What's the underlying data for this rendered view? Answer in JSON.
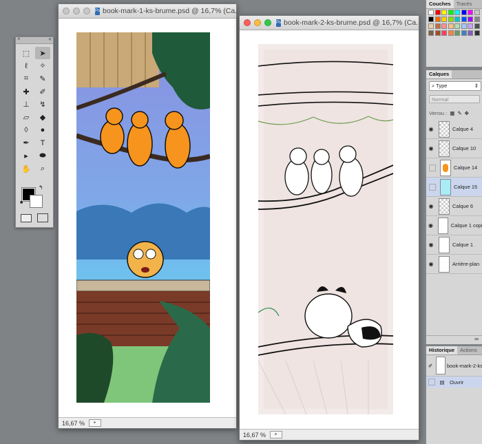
{
  "windows": [
    {
      "title": "book-mark-1-ks-brume.psd @ 16,7% (Ca...",
      "zoom": "16,67 %"
    },
    {
      "title": "book-mark-2-ks-brume.psd @ 16,7% (Ca...",
      "zoom": "16,67 %"
    }
  ],
  "tools": [
    {
      "icon": "marquee-icon",
      "glyph": "⬚"
    },
    {
      "icon": "move-icon",
      "glyph": "➤"
    },
    {
      "icon": "lasso-icon",
      "glyph": "ℓ"
    },
    {
      "icon": "magic-wand-icon",
      "glyph": "✧"
    },
    {
      "icon": "crop-icon",
      "glyph": "⌗"
    },
    {
      "icon": "eyedropper-icon",
      "glyph": "✎"
    },
    {
      "icon": "healing-brush-icon",
      "glyph": "✚"
    },
    {
      "icon": "brush-icon",
      "glyph": "✐"
    },
    {
      "icon": "stamp-icon",
      "glyph": "⊥"
    },
    {
      "icon": "history-brush-icon",
      "glyph": "↯"
    },
    {
      "icon": "eraser-icon",
      "glyph": "▱"
    },
    {
      "icon": "paint-bucket-icon",
      "glyph": "◆"
    },
    {
      "icon": "blur-icon",
      "glyph": "◊"
    },
    {
      "icon": "dodge-icon",
      "glyph": "●"
    },
    {
      "icon": "pen-icon",
      "glyph": "✒"
    },
    {
      "icon": "type-icon",
      "glyph": "T"
    },
    {
      "icon": "path-selection-icon",
      "glyph": "▸"
    },
    {
      "icon": "shape-icon",
      "glyph": "⬬"
    },
    {
      "icon": "hand-icon",
      "glyph": "✋"
    },
    {
      "icon": "zoom-icon",
      "glyph": "⌕"
    }
  ],
  "swatches_panel": {
    "tabs": [
      "Couches",
      "Tracés"
    ]
  },
  "swatch_colors": [
    "#ffffff",
    "#ff0000",
    "#ffff00",
    "#00ff00",
    "#00ffff",
    "#0000ff",
    "#ff00ff",
    "#c8c8c8",
    "#000000",
    "#ff6a00",
    "#ffd200",
    "#88e000",
    "#00c8c8",
    "#0050ff",
    "#a000ff",
    "#888888",
    "#e8d0b0",
    "#c07040",
    "#ff9090",
    "#ffc080",
    "#b0e0b0",
    "#a0c8ff",
    "#c8a0ff",
    "#505050",
    "#806040",
    "#a05028",
    "#ff4060",
    "#ff8040",
    "#60a060",
    "#4080c0",
    "#8060c0",
    "#303030"
  ],
  "layers_panel": {
    "tab": "Calques",
    "kind_filter": "Type",
    "blend_mode": "Normal",
    "lock_label": "Verrou :",
    "layers": [
      {
        "name": "Calque 4",
        "visible": true,
        "thumb": "checker"
      },
      {
        "name": "Calque 10",
        "visible": true,
        "thumb": "checker"
      },
      {
        "name": "Calque 14",
        "visible": false,
        "thumb": "orange"
      },
      {
        "name": "Calque 15",
        "visible": false,
        "thumb": "blue",
        "selected": true
      },
      {
        "name": "Calque 6",
        "visible": true,
        "thumb": "checker"
      },
      {
        "name": "Calque 1 copie",
        "visible": true,
        "thumb": "white"
      },
      {
        "name": "Calque 1",
        "visible": true,
        "thumb": "white"
      },
      {
        "name": "Arrière-plan",
        "visible": true,
        "thumb": "white"
      }
    ]
  },
  "history_panel": {
    "tabs": [
      "Historique",
      "Actions"
    ],
    "snapshot": "book-mark-2-ks",
    "state": "Ouvrir"
  }
}
